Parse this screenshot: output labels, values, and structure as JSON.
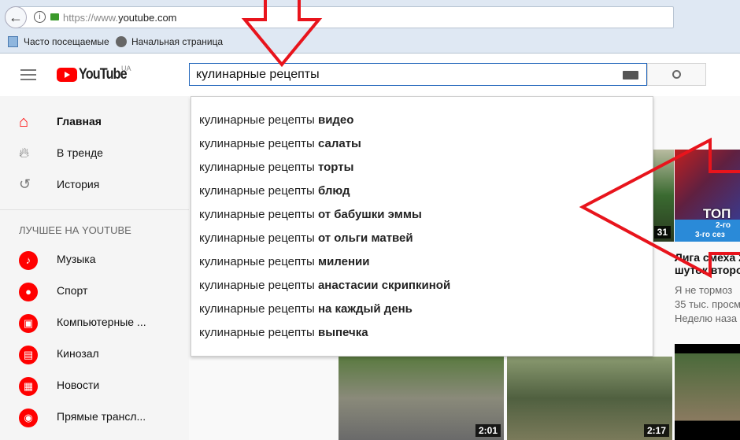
{
  "browser": {
    "url_prefix": "https://www.",
    "url_domain": "youtube.com",
    "bookmarks": [
      "Часто посещаемые",
      "Начальная страница"
    ]
  },
  "header": {
    "logo": "YouTube",
    "region": "UA",
    "search_value": "кулинарные рецепты"
  },
  "suggestions": [
    {
      "base": "кулинарные рецепты ",
      "bold": "видео"
    },
    {
      "base": "кулинарные рецепты ",
      "bold": "салаты"
    },
    {
      "base": "кулинарные рецепты ",
      "bold": "торты"
    },
    {
      "base": "кулинарные рецепты ",
      "bold": "блюд"
    },
    {
      "base": "кулинарные рецепты ",
      "bold": "от бабушки эммы"
    },
    {
      "base": "кулинарные рецепты ",
      "bold": "от ольги матвей"
    },
    {
      "base": "кулинарные рецепты ",
      "bold": "милении"
    },
    {
      "base": "кулинарные рецепты ",
      "bold": "анастасии скрипкиной"
    },
    {
      "base": "кулинарные рецепты ",
      "bold": "на каждый день"
    },
    {
      "base": "кулинарные рецепты ",
      "bold": "выпечка"
    }
  ],
  "sidebar": {
    "main": [
      "Главная",
      "В тренде",
      "История"
    ],
    "section_title": "ЛУЧШЕЕ НА YOUTUBE",
    "best": [
      "Музыка",
      "Спорт",
      "Компьютерные ...",
      "Кинозал",
      "Новости",
      "Прямые трансл..."
    ]
  },
  "videos": {
    "partial_duration": "31",
    "featured": {
      "thumb_line1": "ТОП",
      "thumb_line2": "2-го",
      "thumb_line3": "3-го сез",
      "title1": "Лига смеха 2",
      "title2": "шуток второ",
      "channel": "Я не тормоз",
      "views": "35 тыс. просм",
      "date": "Неделю наза"
    },
    "row2_durations": [
      "2:01",
      "2:17"
    ]
  },
  "colors": {
    "accent": "#ff0000",
    "annotation": "#e8141c"
  }
}
